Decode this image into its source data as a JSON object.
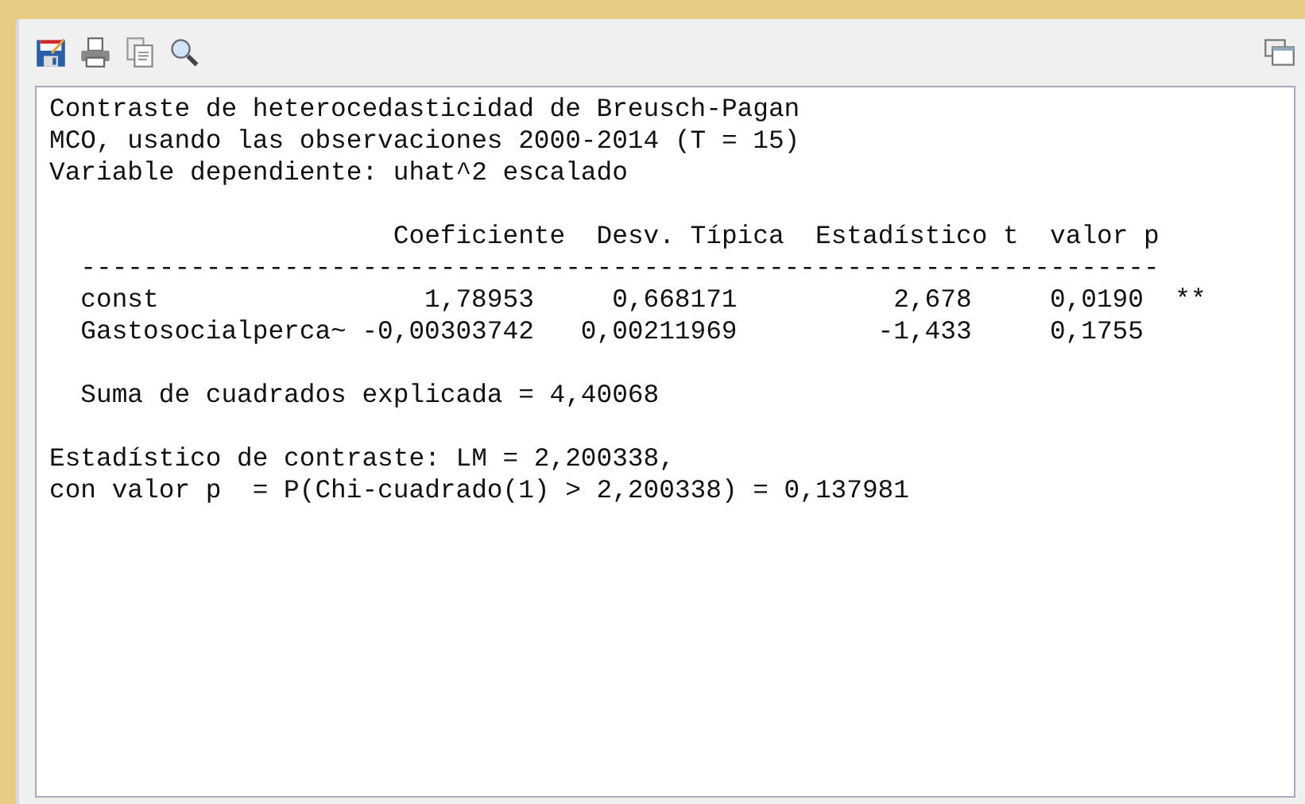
{
  "output": {
    "header_lines": [
      "Contraste de heterocedasticidad de Breusch-Pagan",
      "MCO, usando las observaciones 2000-2014 (T = 15)",
      "Variable dependiente: uhat^2 escalado"
    ],
    "table": {
      "columns": [
        "Coeficiente",
        "Desv. Típica",
        "Estadístico t",
        "valor p"
      ],
      "rule": "---------------------------------------------------------------------",
      "rows": [
        {
          "name": "const",
          "cells": [
            "1,78953",
            "0,668171",
            "2,678",
            "0,0190"
          ],
          "stars": "**"
        },
        {
          "name": "Gastosocialperca~",
          "cells": [
            "-0,00303742",
            "0,00211969",
            "-1,433",
            "0,1755"
          ],
          "stars": ""
        }
      ]
    },
    "summary": "Suma de cuadrados explicada = 4,40068",
    "footer_lines": [
      "Estadístico de contraste: LM = 2,200338,",
      "con valor p  = P(Chi-cuadrado(1) > 2,200338) = 0,137981"
    ]
  }
}
